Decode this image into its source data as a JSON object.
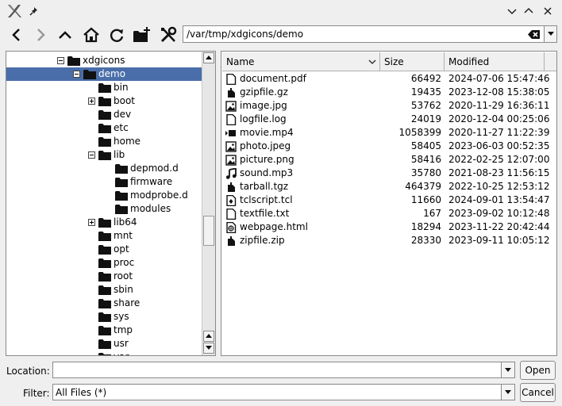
{
  "toolbar": {
    "path": "/var/tmp/xdgicons/demo"
  },
  "tree": {
    "items": [
      {
        "label": "xdgicons",
        "depth": 0,
        "expander": "minus",
        "selected": false
      },
      {
        "label": "demo",
        "depth": 1,
        "expander": "minus",
        "selected": true
      },
      {
        "label": "bin",
        "depth": 2,
        "expander": "none",
        "selected": false
      },
      {
        "label": "boot",
        "depth": 2,
        "expander": "plus",
        "selected": false
      },
      {
        "label": "dev",
        "depth": 2,
        "expander": "none",
        "selected": false
      },
      {
        "label": "etc",
        "depth": 2,
        "expander": "none",
        "selected": false
      },
      {
        "label": "home",
        "depth": 2,
        "expander": "none",
        "selected": false
      },
      {
        "label": "lib",
        "depth": 2,
        "expander": "minus",
        "selected": false
      },
      {
        "label": "depmod.d",
        "depth": 3,
        "expander": "none",
        "selected": false
      },
      {
        "label": "firmware",
        "depth": 3,
        "expander": "none",
        "selected": false
      },
      {
        "label": "modprobe.d",
        "depth": 3,
        "expander": "none",
        "selected": false
      },
      {
        "label": "modules",
        "depth": 3,
        "expander": "none",
        "selected": false
      },
      {
        "label": "lib64",
        "depth": 2,
        "expander": "plus",
        "selected": false
      },
      {
        "label": "mnt",
        "depth": 2,
        "expander": "none",
        "selected": false
      },
      {
        "label": "opt",
        "depth": 2,
        "expander": "none",
        "selected": false
      },
      {
        "label": "proc",
        "depth": 2,
        "expander": "none",
        "selected": false
      },
      {
        "label": "root",
        "depth": 2,
        "expander": "none",
        "selected": false
      },
      {
        "label": "sbin",
        "depth": 2,
        "expander": "none",
        "selected": false
      },
      {
        "label": "share",
        "depth": 2,
        "expander": "none",
        "selected": false
      },
      {
        "label": "sys",
        "depth": 2,
        "expander": "none",
        "selected": false
      },
      {
        "label": "tmp",
        "depth": 2,
        "expander": "none",
        "selected": false
      },
      {
        "label": "usr",
        "depth": 2,
        "expander": "none",
        "selected": false
      },
      {
        "label": "var",
        "depth": 2,
        "expander": "none",
        "selected": false
      }
    ]
  },
  "files": {
    "headers": {
      "name": "Name",
      "size": "Size",
      "modified": "Modified"
    },
    "rows": [
      {
        "name": "document.pdf",
        "size": "66492",
        "modified": "2024-07-06 15:47:46",
        "icon": "document-icon"
      },
      {
        "name": "gzipfile.gz",
        "size": "19435",
        "modified": "2023-12-08 15:38:05",
        "icon": "archive-icon"
      },
      {
        "name": "image.jpg",
        "size": "53762",
        "modified": "2020-11-29 16:36:11",
        "icon": "image-icon"
      },
      {
        "name": "logfile.log",
        "size": "24019",
        "modified": "2020-12-04 00:25:06",
        "icon": "document-icon"
      },
      {
        "name": "movie.mp4",
        "size": "1058399",
        "modified": "2020-11-27 11:22:39",
        "icon": "video-icon"
      },
      {
        "name": "photo.jpeg",
        "size": "58405",
        "modified": "2023-06-03 00:52:35",
        "icon": "image-icon"
      },
      {
        "name": "picture.png",
        "size": "58416",
        "modified": "2022-02-25 12:07:00",
        "icon": "image-icon"
      },
      {
        "name": "sound.mp3",
        "size": "35780",
        "modified": "2021-08-23 11:56:15",
        "icon": "music-icon"
      },
      {
        "name": "tarball.tgz",
        "size": "464379",
        "modified": "2022-10-25 12:53:12",
        "icon": "archive-icon"
      },
      {
        "name": "tclscript.tcl",
        "size": "11660",
        "modified": "2024-09-01 13:54:47",
        "icon": "script-icon"
      },
      {
        "name": "textfile.txt",
        "size": "167",
        "modified": "2023-09-02 10:12:48",
        "icon": "document-icon"
      },
      {
        "name": "webpage.html",
        "size": "18294",
        "modified": "2023-11-22 20:42:44",
        "icon": "html-icon"
      },
      {
        "name": "zipfile.zip",
        "size": "28330",
        "modified": "2023-09-11 10:05:12",
        "icon": "archive-icon"
      }
    ]
  },
  "bottom": {
    "location_label": "Location:",
    "location_value": "",
    "filter_label": "Filter:",
    "filter_value": "All Files (*)",
    "open_label": "Open",
    "cancel_label": "Cancel"
  },
  "colors": {
    "selection": "#4a6ea9",
    "background": "#efefef"
  }
}
